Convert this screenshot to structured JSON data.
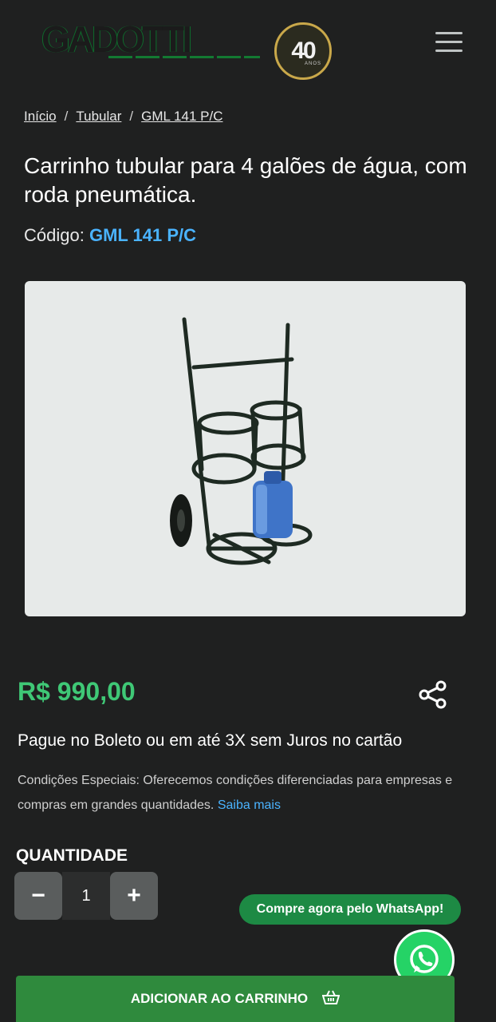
{
  "header": {
    "logo_text": "GADOTTI",
    "badge_number": "40",
    "badge_sub": "ANOS"
  },
  "breadcrumb": {
    "items": [
      "Início",
      "Tubular",
      "GML 141 P/C"
    ],
    "separator": "/"
  },
  "product": {
    "title": "Carrinho tubular para 4 galões de água, com roda pneumática.",
    "code_label": "Código:",
    "code_value": "GML 141 P/C",
    "price": "R$ 990,00",
    "payment": "Pague no Boleto ou em até 3X sem Juros no cartão",
    "conditions_text": "Condições Especiais: Oferecemos condições diferenciadas para empresas e compras em grandes quantidades.",
    "conditions_link": "Saiba mais"
  },
  "quantity": {
    "label": "QUANTIDADE",
    "minus": "−",
    "value": "1",
    "plus": "+"
  },
  "whatsapp": {
    "label": "Compre agora pelo WhatsApp!"
  },
  "cart": {
    "label": "ADICIONAR AO CARRINHO"
  },
  "colors": {
    "background": "#1f2020",
    "price": "#3fc876",
    "link": "#4ab3ff",
    "whatsapp": "#25d366",
    "cart_button": "#2f8a3d"
  },
  "icons": [
    "menu-icon",
    "share-icon",
    "whatsapp-icon",
    "basket-icon"
  ]
}
